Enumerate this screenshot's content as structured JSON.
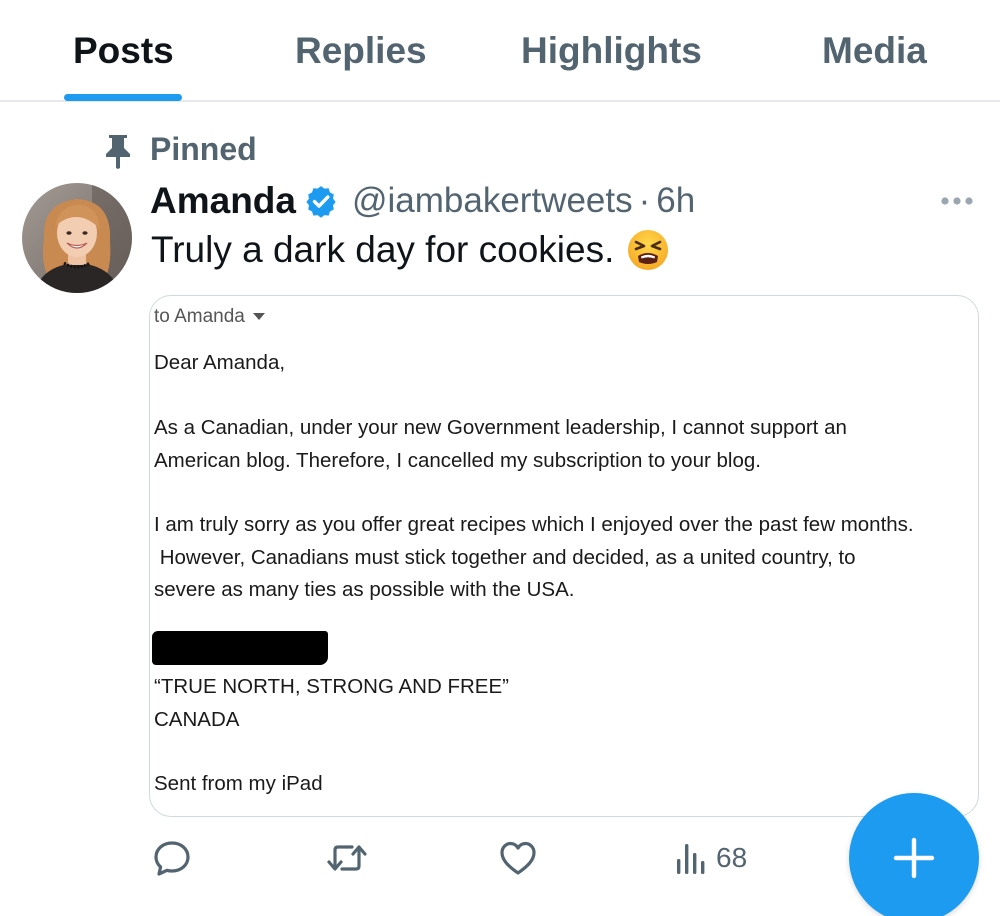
{
  "tabs": [
    {
      "label": "Posts",
      "active": true
    },
    {
      "label": "Replies",
      "active": false
    },
    {
      "label": "Highlights",
      "active": false
    },
    {
      "label": "Media",
      "active": false
    }
  ],
  "pinned_label": "Pinned",
  "post": {
    "display_name": "Amanda",
    "verified": true,
    "handle": "@iambakertweets",
    "separator": "·",
    "time": "6h",
    "text": "Truly a dark day for cookies.",
    "emoji": "tired-face-emoji",
    "media": {
      "to_line": "to Amanda",
      "lines": [
        "Dear Amanda,",
        "As a Canadian, under your new Government leadership, I cannot support an",
        "American blog.  Therefore, I cancelled my subscription to your blog.",
        "I am truly sorry as you offer great recipes which I enjoyed over the past few months.",
        " However, Canadians must stick together and decided, as a united country, to",
        "severe as many ties as possible with the USA.",
        "“TRUE NORTH, STRONG AND FREE”",
        "CANADA",
        "Sent from my iPad"
      ]
    },
    "actions": {
      "reply_icon": "reply-icon",
      "repost_icon": "repost-icon",
      "like_icon": "heart-icon",
      "views_icon": "views-icon",
      "views_count": "68"
    }
  },
  "fab_icon": "plus-icon",
  "colors": {
    "accent": "#1d9bf0",
    "text_primary": "#0f1419",
    "text_secondary": "#536471",
    "border": "#cfd9de"
  }
}
